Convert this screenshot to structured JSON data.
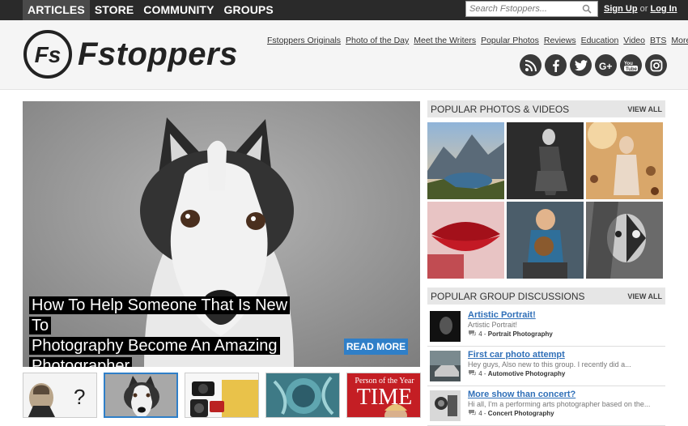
{
  "topnav": {
    "items": [
      {
        "label": "ARTICLES",
        "active": true
      },
      {
        "label": "STORE",
        "active": false
      },
      {
        "label": "COMMUNITY",
        "active": false
      },
      {
        "label": "GROUPS",
        "active": false
      }
    ],
    "search_placeholder": "Search Fstoppers...",
    "signup_label": "Sign Up",
    "or_label": "or",
    "login_label": "Log In"
  },
  "header": {
    "logo_mark": "Fs",
    "brand": "Fstoppers",
    "links": [
      "Fstoppers Originals",
      "Photo of the Day",
      "Meet the Writers",
      "Popular Photos",
      "Reviews",
      "Education",
      "Video",
      "BTS",
      "More..."
    ],
    "social_icons": [
      "rss-icon",
      "facebook-icon",
      "twitter-icon",
      "google-plus-icon",
      "youtube-icon",
      "instagram-icon"
    ]
  },
  "hero": {
    "title_line1": "How To Help Someone That Is New To",
    "title_line2": "Photography Become An Amazing",
    "title_line3": "Photographer",
    "read_more": "READ MORE"
  },
  "popular_photos": {
    "title": "POPULAR PHOTOS & VIDEOS",
    "view_all": "VIEW ALL"
  },
  "popular_groups": {
    "title": "POPULAR GROUP DISCUSSIONS",
    "view_all": "VIEW ALL",
    "items": [
      {
        "title": "Artistic Portrait!",
        "snippet": "Artistic Portrait!",
        "count": "4",
        "group": "Portrait Photography"
      },
      {
        "title": "First car photo attempt",
        "snippet": "Hey guys, Also new to this group. I recently did a...",
        "count": "4",
        "group": "Automotive Photography"
      },
      {
        "title": "More show than concert?",
        "snippet": "Hi all, I'm a performing arts photographer based on the...",
        "count": "4",
        "group": "Concert Photography"
      }
    ]
  },
  "thumbs": {
    "t5_line1": "Person of the Year",
    "t5_line2": "TIME"
  },
  "colors": {
    "accent": "#2f7fc8",
    "topbar": "#2a2a2a",
    "link": "#2f6fb8"
  }
}
